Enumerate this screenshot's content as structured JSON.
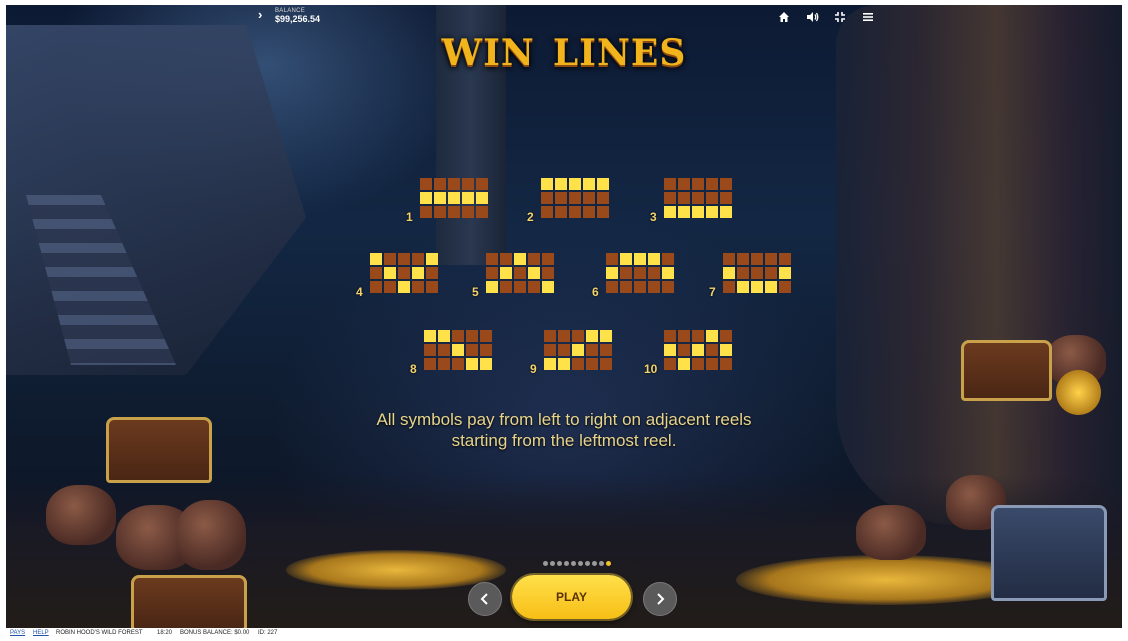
{
  "header": {
    "balance_label": "BALANCE",
    "balance_value": "$99,256.54",
    "icons": [
      "home-icon",
      "sound-icon",
      "fullscreen-icon",
      "menu-icon"
    ]
  },
  "page": {
    "title_word1": "WIN",
    "title_word2": "LINES",
    "description_line1": "All symbols pay from left to right on adjacent reels",
    "description_line2": "starting from the leftmost reel."
  },
  "win_lines": [
    {
      "number": "1",
      "pattern": [
        1,
        1,
        1,
        1,
        1
      ]
    },
    {
      "number": "2",
      "pattern": [
        0,
        0,
        0,
        0,
        0
      ]
    },
    {
      "number": "3",
      "pattern": [
        2,
        2,
        2,
        2,
        2
      ]
    },
    {
      "number": "4",
      "pattern": [
        0,
        1,
        2,
        1,
        0
      ]
    },
    {
      "number": "5",
      "pattern": [
        2,
        1,
        0,
        1,
        2
      ]
    },
    {
      "number": "6",
      "pattern": [
        1,
        0,
        0,
        0,
        1
      ]
    },
    {
      "number": "7",
      "pattern": [
        1,
        2,
        2,
        2,
        1
      ]
    },
    {
      "number": "8",
      "pattern": [
        0,
        0,
        1,
        2,
        2
      ]
    },
    {
      "number": "9",
      "pattern": [
        2,
        2,
        1,
        0,
        0
      ]
    },
    {
      "number": "10",
      "pattern": [
        1,
        2,
        1,
        0,
        1
      ]
    }
  ],
  "pager": {
    "total": 10,
    "active": 10
  },
  "controls": {
    "play_label": "PLAY"
  },
  "footer": {
    "pays_link": "PAYS",
    "help_link": "HELP",
    "game_name": "ROBIN HOOD'S WILD FOREST",
    "time": "18:20",
    "bonus_balance": "BONUS BALANCE: $0.00",
    "id": "ID: 227"
  },
  "colors": {
    "title": "#f2b41c",
    "cell_on": "#ffe14a",
    "cell_off": "#9a4a1a",
    "play_button": "#f7be16",
    "description": "#e7d48c"
  }
}
